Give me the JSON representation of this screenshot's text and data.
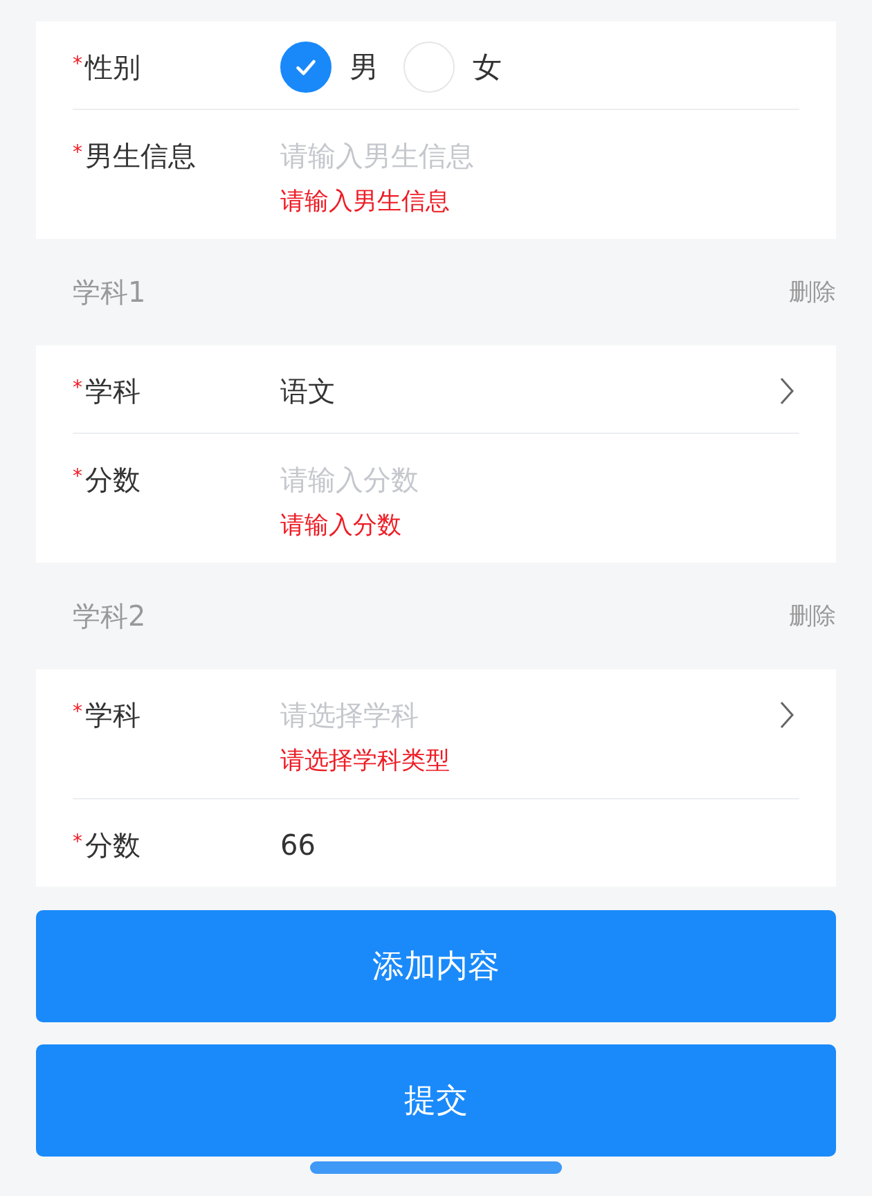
{
  "form": {
    "gender": {
      "mark": "*",
      "label": "性别",
      "options": [
        {
          "label": "男",
          "selected": true
        },
        {
          "label": "女",
          "selected": false
        }
      ]
    },
    "male_info": {
      "mark": "*",
      "label": "男生信息",
      "placeholder": "请输入男生信息",
      "error": "请输入男生信息"
    }
  },
  "subjects": [
    {
      "title": "学科1",
      "delete": "删除",
      "fields": [
        {
          "kind": "select",
          "mark": "*",
          "label": "学科",
          "value": "语文"
        },
        {
          "kind": "input",
          "mark": "*",
          "label": "分数",
          "placeholder": "请输入分数",
          "error": "请输入分数"
        }
      ]
    },
    {
      "title": "学科2",
      "delete": "删除",
      "fields": [
        {
          "kind": "select",
          "mark": "*",
          "label": "学科",
          "placeholder": "请选择学科",
          "error": "请选择学科类型"
        },
        {
          "kind": "input",
          "mark": "*",
          "label": "分数",
          "value": "66"
        }
      ]
    }
  ],
  "buttons": [
    {
      "label": "添加内容"
    },
    {
      "label": "提交"
    }
  ]
}
